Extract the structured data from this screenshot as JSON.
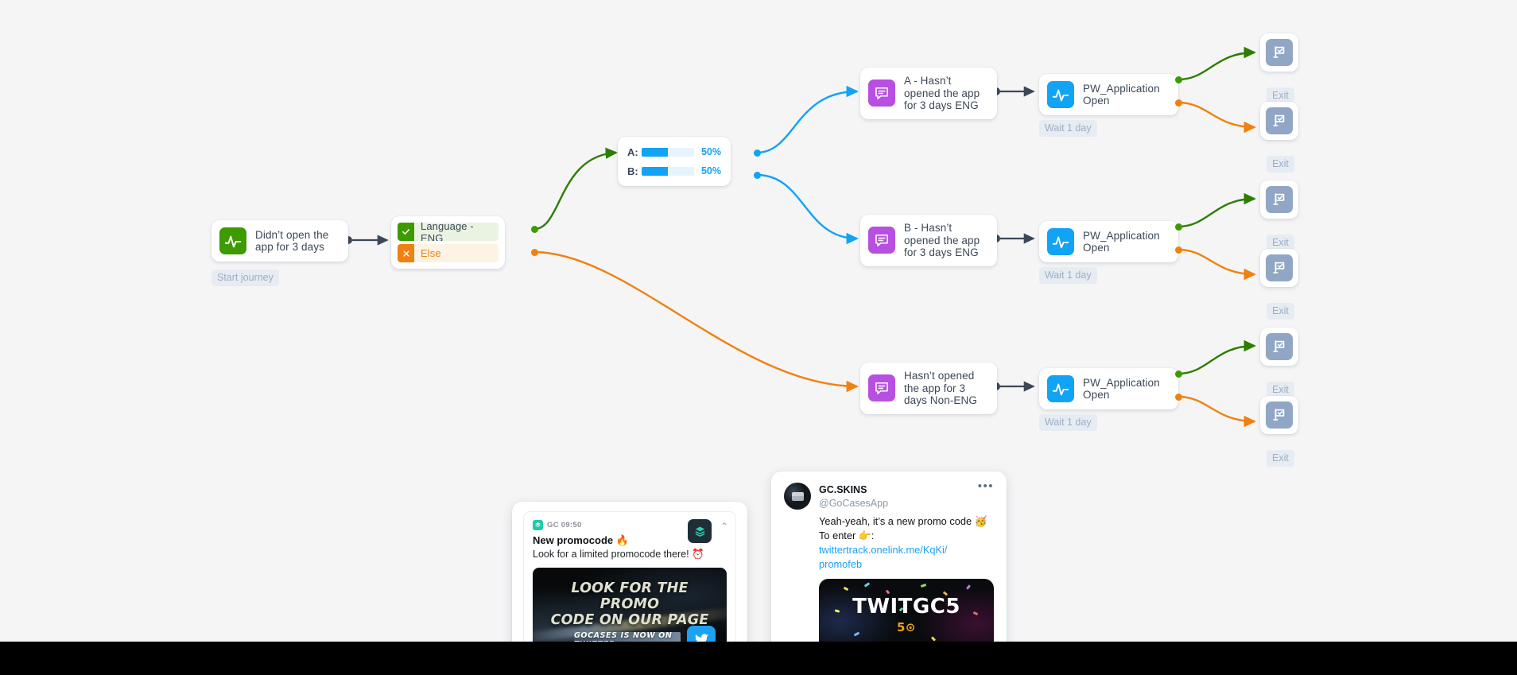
{
  "canvas": {
    "background_color": "#f5f5f6",
    "bottom_bar_color": "#000000"
  },
  "palette": {
    "green": "#3d9b00",
    "orange": "#f08110",
    "blue": "#11a3f5",
    "purple": "#b74fe0",
    "exit_gray": "#90a6c4",
    "edge_dark": "#3c4858",
    "chip_bg": "#e7ecf2",
    "chip_text": "#9baec6"
  },
  "nodes": {
    "trigger": {
      "label": "Didn’t open the\napp for 3 days",
      "icon": "activity-pulse-icon",
      "caption": "Start journey"
    },
    "condition": {
      "rows": [
        {
          "badge": "check-icon",
          "label": "Language - ENG",
          "state": "yes"
        },
        {
          "badge": "close-icon",
          "label": "Else",
          "state": "no"
        }
      ]
    },
    "split": {
      "rows": [
        {
          "key": "A:",
          "percent": "50%",
          "value": 50
        },
        {
          "key": "B:",
          "percent": "50%",
          "value": 50
        }
      ]
    },
    "messages": [
      {
        "label": "A - Hasn’t\nopened the app\nfor 3 days ENG",
        "icon": "message-bubble-icon"
      },
      {
        "label": "B - Hasn’t\nopened the app\nfor 3 days ENG",
        "icon": "message-bubble-icon"
      },
      {
        "label": "Hasn’t opened\nthe app for 3\ndays Non-ENG",
        "icon": "message-bubble-icon"
      }
    ],
    "events": [
      {
        "label": "PW_Application\nOpen",
        "icon": "activity-pulse-icon",
        "caption": "Wait 1 day"
      },
      {
        "label": "PW_Application\nOpen",
        "icon": "activity-pulse-icon",
        "caption": "Wait 1 day"
      },
      {
        "label": "PW_Application\nOpen",
        "icon": "activity-pulse-icon",
        "caption": "Wait 1 day"
      }
    ],
    "exits": [
      {
        "caption": "Exit",
        "icon": "flag-check-icon"
      },
      {
        "caption": "Exit",
        "icon": "flag-check-icon"
      },
      {
        "caption": "Exit",
        "icon": "flag-check-icon"
      },
      {
        "caption": "Exit",
        "icon": "flag-check-icon"
      },
      {
        "caption": "Exit",
        "icon": "flag-check-icon"
      },
      {
        "caption": "Exit",
        "icon": "flag-check-icon"
      }
    ]
  },
  "previews": {
    "push": {
      "app_time": "GC 09:50",
      "title": "New promocode 🔥",
      "body": "Look for a limited promocode there! ⏰",
      "chevron": "⌃",
      "hero_line1": "LOOK FOR THE PROMO",
      "hero_line2": "CODE ON OUR PAGE",
      "hero_ribbon": "GOCASES IS NOW ON TWITTER"
    },
    "tweet": {
      "name": "GC.SKINS",
      "handle": "@GoCasesApp",
      "more": "•••",
      "body_line1": "Yeah-yeah, it’s a new promo code 🥳",
      "body_line2": "To enter 👉:",
      "link_line1": "twittertrack.onelink.me/KqKi/",
      "link_line2": "promofeb",
      "hero_code": "TWITGC5",
      "hero_sub": "5⊙"
    }
  }
}
